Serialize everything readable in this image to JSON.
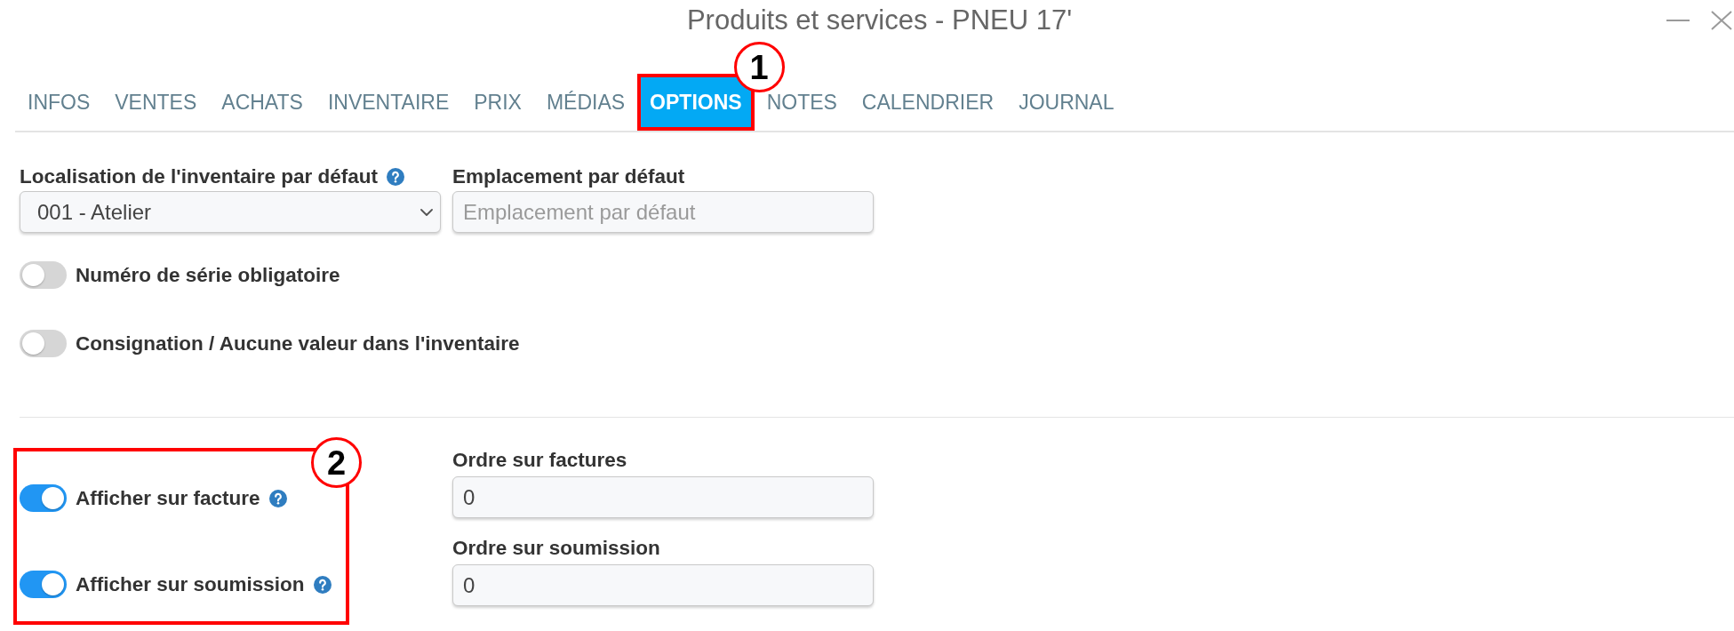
{
  "window": {
    "title": "Produits et services - PNEU 17'"
  },
  "tabs": [
    {
      "label": "INFOS",
      "selected": false
    },
    {
      "label": "VENTES",
      "selected": false
    },
    {
      "label": "ACHATS",
      "selected": false
    },
    {
      "label": "INVENTAIRE",
      "selected": false
    },
    {
      "label": "PRIX",
      "selected": false
    },
    {
      "label": "MÉDIAS",
      "selected": false
    },
    {
      "label": "OPTIONS",
      "selected": true,
      "annotation": "1"
    },
    {
      "label": "NOTES",
      "selected": false
    },
    {
      "label": "CALENDRIER",
      "selected": false
    },
    {
      "label": "JOURNAL",
      "selected": false
    }
  ],
  "fields": [
    {
      "kind": "select",
      "label": "Localisation de l'inventaire par défaut",
      "help": true,
      "value": "001 - Atelier"
    },
    {
      "kind": "text",
      "label": "Emplacement par défaut",
      "help": false,
      "placeholder": "Emplacement par défaut"
    }
  ],
  "toggles": [
    {
      "label": "Numéro de série obligatoire",
      "on": false,
      "help": false
    },
    {
      "label": "Consignation / Aucune valeur dans l'inventaire",
      "on": false,
      "help": false
    }
  ],
  "display_section": {
    "annotation": "2",
    "toggles": [
      {
        "label": "Afficher sur facture",
        "on": true,
        "help": true
      },
      {
        "label": "Afficher sur soumission",
        "on": true,
        "help": true
      }
    ],
    "order_fields": [
      {
        "label": "Ordre sur factures",
        "value": "0"
      },
      {
        "label": "Ordre sur soumission",
        "value": "0"
      }
    ]
  }
}
